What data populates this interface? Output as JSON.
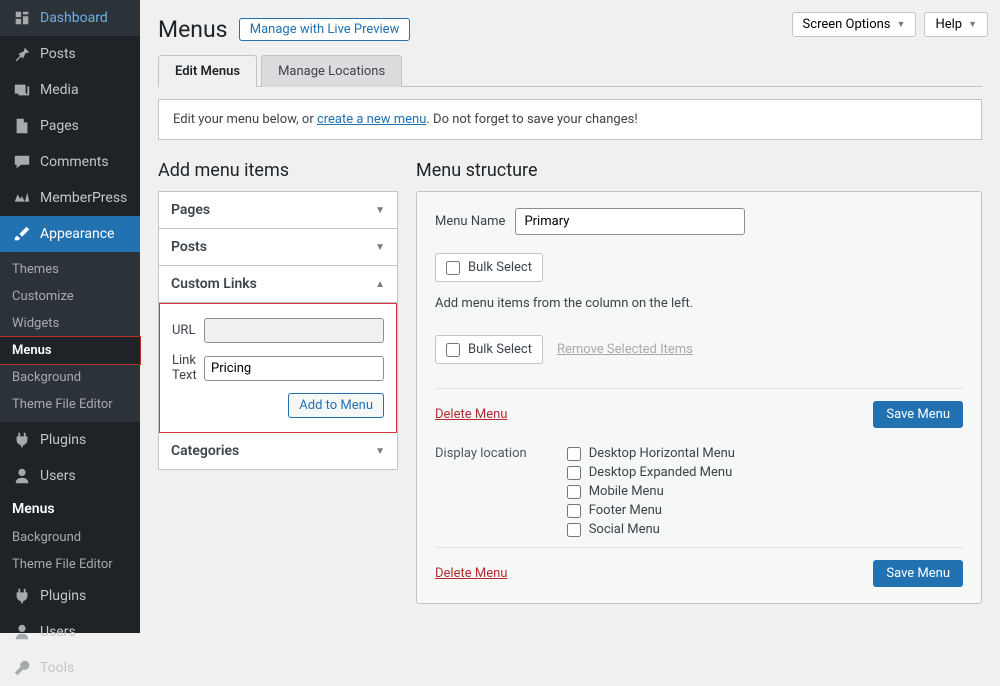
{
  "topbar": {
    "screen_options": "Screen Options",
    "help": "Help"
  },
  "sidebar": {
    "items": [
      {
        "id": "dashboard",
        "label": "Dashboard"
      },
      {
        "id": "posts",
        "label": "Posts"
      },
      {
        "id": "media",
        "label": "Media"
      },
      {
        "id": "pages",
        "label": "Pages"
      },
      {
        "id": "comments",
        "label": "Comments"
      },
      {
        "id": "memberpress",
        "label": "MemberPress"
      },
      {
        "id": "appearance",
        "label": "Appearance"
      }
    ],
    "appearance_sub": [
      {
        "id": "themes",
        "label": "Themes"
      },
      {
        "id": "customize",
        "label": "Customize"
      },
      {
        "id": "widgets",
        "label": "Widgets"
      },
      {
        "id": "menus",
        "label": "Menus",
        "current": true
      },
      {
        "id": "background",
        "label": "Background"
      },
      {
        "id": "theme-file-editor",
        "label": "Theme File Editor"
      }
    ],
    "items2": [
      {
        "id": "plugins",
        "label": "Plugins"
      },
      {
        "id": "users",
        "label": "Users"
      }
    ],
    "extra": [
      {
        "id": "extra-menus",
        "label": "Menus",
        "bold": true
      },
      {
        "id": "extra-background",
        "label": "Background"
      },
      {
        "id": "extra-theme-file-editor",
        "label": "Theme File Editor"
      }
    ],
    "items3": [
      {
        "id": "plugins2",
        "label": "Plugins"
      },
      {
        "id": "users2",
        "label": "Users"
      },
      {
        "id": "tools",
        "label": "Tools"
      }
    ]
  },
  "page": {
    "title": "Menus",
    "live_preview": "Manage with Live Preview",
    "tabs": {
      "edit": "Edit Menus",
      "locations": "Manage Locations"
    },
    "notice_pre": "Edit your menu below, or ",
    "notice_link": "create a new menu",
    "notice_post": ". Do not forget to save your changes!"
  },
  "left": {
    "heading": "Add menu items",
    "panels": {
      "pages": "Pages",
      "posts": "Posts",
      "custom": "Custom Links",
      "categories": "Categories"
    },
    "custom": {
      "url_label": "URL",
      "url_value": "",
      "linktext_label": "Link Text",
      "linktext_value": "Pricing",
      "add_button": "Add to Menu"
    }
  },
  "right": {
    "heading": "Menu structure",
    "menu_name_label": "Menu Name",
    "menu_name_value": "Primary",
    "bulk_select": "Bulk Select",
    "hint": "Add menu items from the column on the left.",
    "remove_selected": "Remove Selected Items",
    "delete_menu": "Delete Menu",
    "save_menu": "Save Menu",
    "display_location_label": "Display location",
    "locations": [
      "Desktop Horizontal Menu",
      "Desktop Expanded Menu",
      "Mobile Menu",
      "Footer Menu",
      "Social Menu"
    ]
  }
}
